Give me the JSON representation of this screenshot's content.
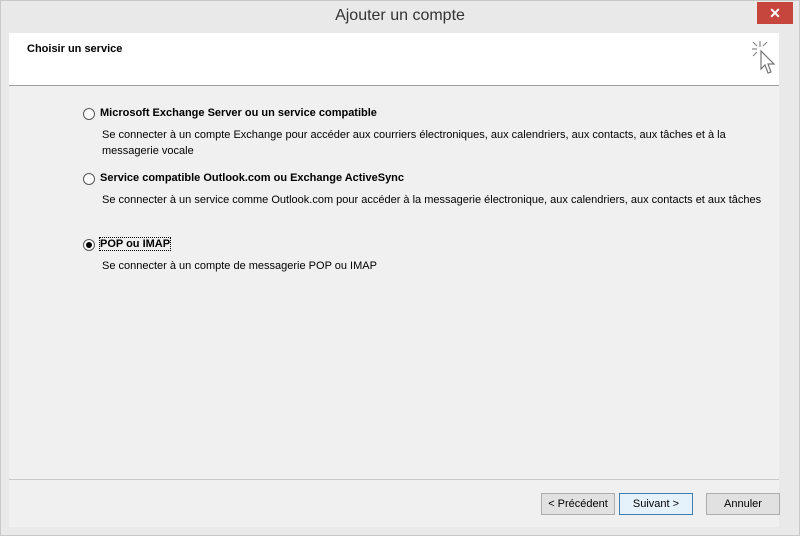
{
  "window": {
    "title": "Ajouter un compte",
    "close_symbol": "✕",
    "accent_close": "#c6453d"
  },
  "header": {
    "title": "Choisir un service",
    "icon": "wizard-cursor-icon"
  },
  "options": [
    {
      "label": "Microsoft Exchange Server ou un service compatible",
      "description": "Se connecter à un compte Exchange pour accéder aux courriers électroniques, aux calendriers, aux contacts, aux tâches et à la messagerie vocale",
      "selected": false
    },
    {
      "label": "Service compatible Outlook.com ou Exchange ActiveSync",
      "description": "Se connecter à un service comme Outlook.com pour accéder à la messagerie électronique, aux calendriers, aux contacts et aux tâches",
      "selected": false
    },
    {
      "label": "POP ou IMAP",
      "description": "Se connecter à un compte de messagerie POP ou IMAP",
      "selected": true
    }
  ],
  "buttons": {
    "previous": "< Précédent",
    "next": "Suivant >",
    "cancel": "Annuler"
  }
}
